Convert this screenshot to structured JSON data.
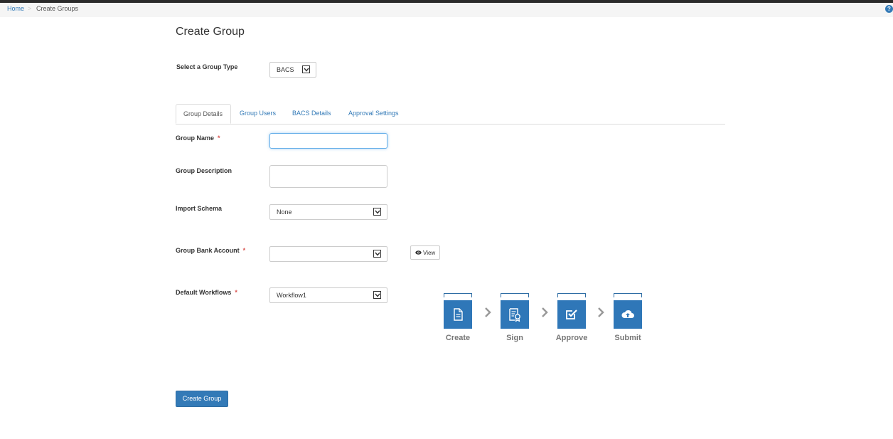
{
  "breadcrumb": {
    "home": "Home",
    "separator": ">",
    "current": "Create Groups"
  },
  "help_icon": "?",
  "page_title": "Create Group",
  "group_type": {
    "label": "Select a Group Type",
    "value": "BACS"
  },
  "tabs": [
    {
      "label": "Group Details",
      "active": true
    },
    {
      "label": "Group Users",
      "active": false
    },
    {
      "label": "BACS Details",
      "active": false
    },
    {
      "label": "Approval Settings",
      "active": false
    }
  ],
  "form": {
    "group_name": {
      "label": "Group Name",
      "required": "*",
      "value": ""
    },
    "group_description": {
      "label": "Group Description",
      "value": ""
    },
    "import_schema": {
      "label": "Import Schema",
      "value": "None"
    },
    "group_bank_account": {
      "label": "Group Bank Account",
      "required": "*",
      "value": ""
    },
    "default_workflows": {
      "label": "Default Workflows",
      "required": "*",
      "value": "Workflow1"
    }
  },
  "view_button": {
    "label": "View",
    "icon": "eye-icon"
  },
  "workflow_steps": [
    {
      "label": "Create",
      "icon": "document-icon"
    },
    {
      "label": "Sign",
      "icon": "certificate-icon"
    },
    {
      "label": "Approve",
      "icon": "approve-check-icon"
    },
    {
      "label": "Submit",
      "icon": "cloud-upload-icon"
    }
  ],
  "create_button": "Create Group",
  "colors": {
    "primary": "#337ab7",
    "workflow_blue": "#2f77b8",
    "required": "#d9534f",
    "link": "#337ab7"
  }
}
